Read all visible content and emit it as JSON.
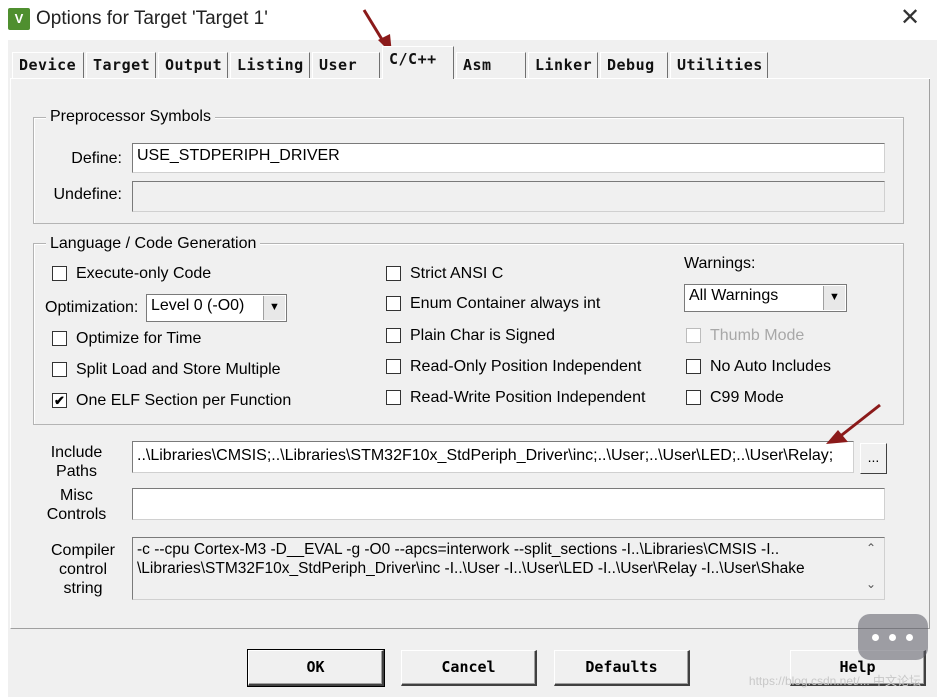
{
  "window": {
    "title": "Options for Target 'Target 1'",
    "close_glyph": "✕",
    "icon_letter": "V"
  },
  "tabs": [
    {
      "label": "Device"
    },
    {
      "label": "Target"
    },
    {
      "label": "Output"
    },
    {
      "label": "Listing"
    },
    {
      "label": "User"
    },
    {
      "label": "C/C++"
    },
    {
      "label": "Asm"
    },
    {
      "label": "Linker"
    },
    {
      "label": "Debug"
    },
    {
      "label": "Utilities"
    }
  ],
  "active_tab": "C/C++",
  "preprocessor": {
    "legend": "Preprocessor Symbols",
    "define_label": "Define:",
    "define_value": "USE_STDPERIPH_DRIVER",
    "undefine_label": "Undefine:",
    "undefine_value": ""
  },
  "language": {
    "legend": "Language / Code Generation",
    "execute_only": {
      "label": "Execute-only Code",
      "checked": false
    },
    "optimization_label": "Optimization:",
    "optimization_value": "Level 0 (-O0)",
    "optimize_time": {
      "label": "Optimize for Time",
      "checked": false
    },
    "split_load": {
      "label": "Split Load and Store Multiple",
      "checked": false
    },
    "one_elf": {
      "label": "One ELF Section per Function",
      "checked": true
    },
    "strict_ansi": {
      "label": "Strict ANSI C",
      "checked": false
    },
    "enum_container": {
      "label": "Enum Container always int",
      "checked": false
    },
    "plain_char": {
      "label": "Plain Char is Signed",
      "checked": false
    },
    "ro_pos": {
      "label": "Read-Only Position Independent",
      "checked": false
    },
    "rw_pos": {
      "label": "Read-Write Position Independent",
      "checked": false
    },
    "warnings_label": "Warnings:",
    "warnings_value": "All Warnings",
    "thumb_mode": {
      "label": "Thumb Mode",
      "checked": false,
      "disabled": true
    },
    "no_auto_includes": {
      "label": "No Auto Includes",
      "checked": false
    },
    "c99_mode": {
      "label": "C99 Mode",
      "checked": false
    }
  },
  "include_paths": {
    "label_line1": "Include",
    "label_line2": "Paths",
    "value": "..\\Libraries\\CMSIS;..\\Libraries\\STM32F10x_StdPeriph_Driver\\inc;..\\User;..\\User\\LED;..\\User\\Relay;",
    "browse_label": "..."
  },
  "misc_controls": {
    "label_line1": "Misc",
    "label_line2": "Controls",
    "value": ""
  },
  "compiler_string": {
    "label_line1": "Compiler",
    "label_line2": "control",
    "label_line3": "string",
    "line1": "-c --cpu Cortex-M3 -D__EVAL -g -O0 --apcs=interwork --split_sections -I..\\Libraries\\CMSIS -I..",
    "line2": "\\Libraries\\STM32F10x_StdPeriph_Driver\\inc -I..\\User -I..\\User\\LED -I..\\User\\Relay -I..\\User\\Shake",
    "scroll_up": "⌃",
    "scroll_down": "⌄"
  },
  "buttons": {
    "ok": "OK",
    "cancel": "Cancel",
    "defaults": "Defaults",
    "help": "Help"
  },
  "watermark": "https://blog.csdn.net/... 中文论坛",
  "colors": {
    "arrow": "#8b1a1a",
    "dialog_bg": "#f0f0f0",
    "checkmark": "#000000"
  }
}
